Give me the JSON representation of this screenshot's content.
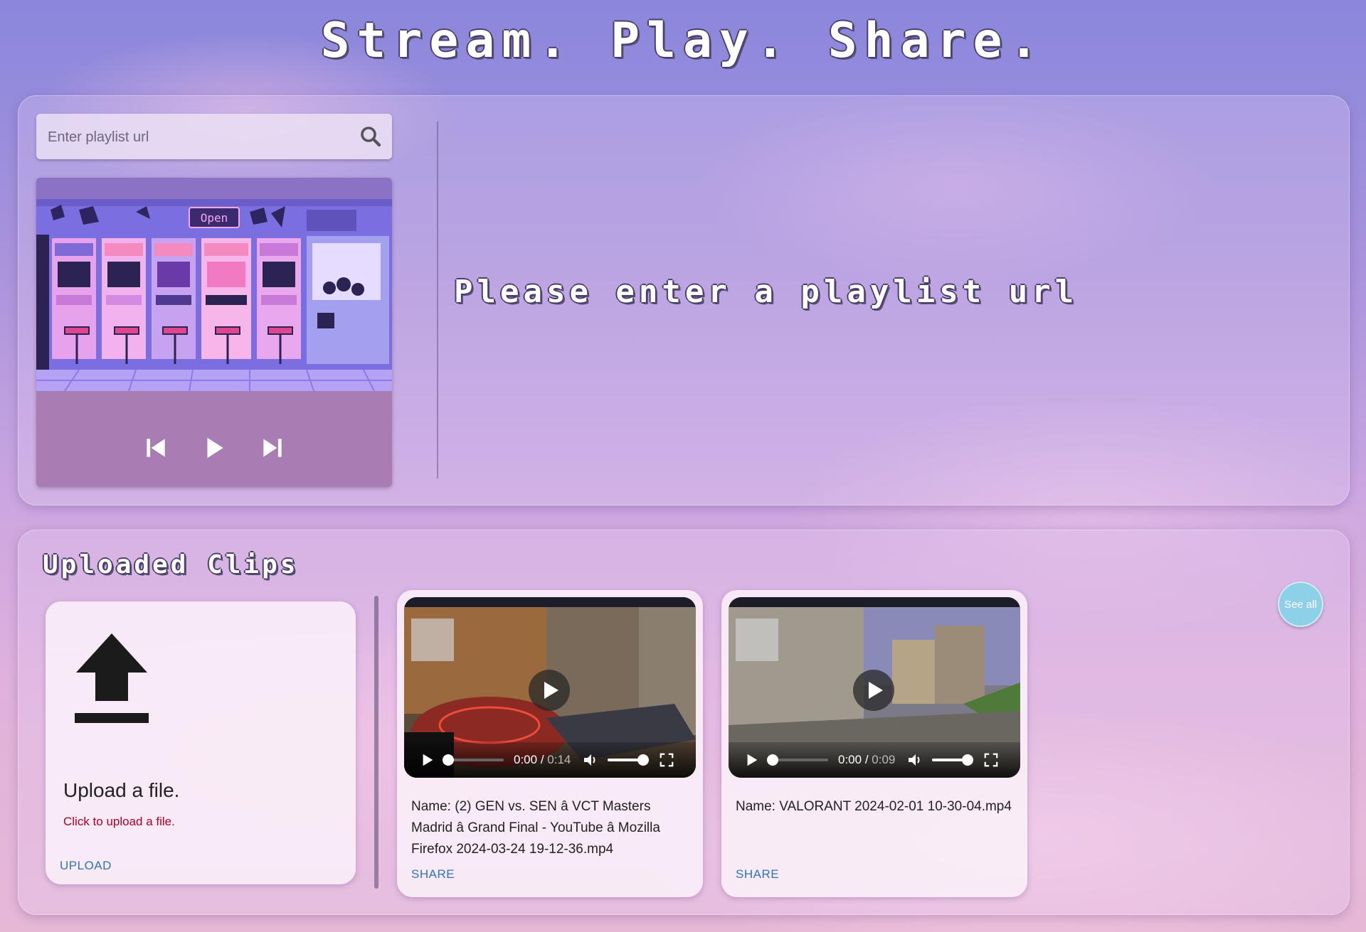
{
  "header": {
    "title": "Stream. Play. Share."
  },
  "search": {
    "placeholder": "Enter playlist url",
    "value": ""
  },
  "player": {
    "prev_icon": "skip-previous-icon",
    "play_icon": "play-icon",
    "next_icon": "skip-next-icon",
    "sign_text": "Open"
  },
  "main": {
    "prompt": "Please enter a playlist url"
  },
  "clips": {
    "title": "Uploaded Clips",
    "see_all": "See all",
    "upload": {
      "title": "Upload a file.",
      "subtitle": "Click to upload a file.",
      "button": "UPLOAD"
    },
    "items": [
      {
        "name": "Name: (2) GEN vs. SEN â VCT Masters Madrid â Grand Final - YouTube â Mozilla Firefox 2024-03-24 19-12-36.mp4",
        "current": "0:00",
        "total": "0:14",
        "share": "SHARE"
      },
      {
        "name": "Name: VALORANT 2024-02-01 10-30-04.mp4",
        "current": "0:00",
        "total": "0:09",
        "share": "SHARE"
      }
    ]
  },
  "colors": {
    "error": "#b00020",
    "link": "#2f74c0",
    "see_all_bg": "#8ed0e8"
  }
}
